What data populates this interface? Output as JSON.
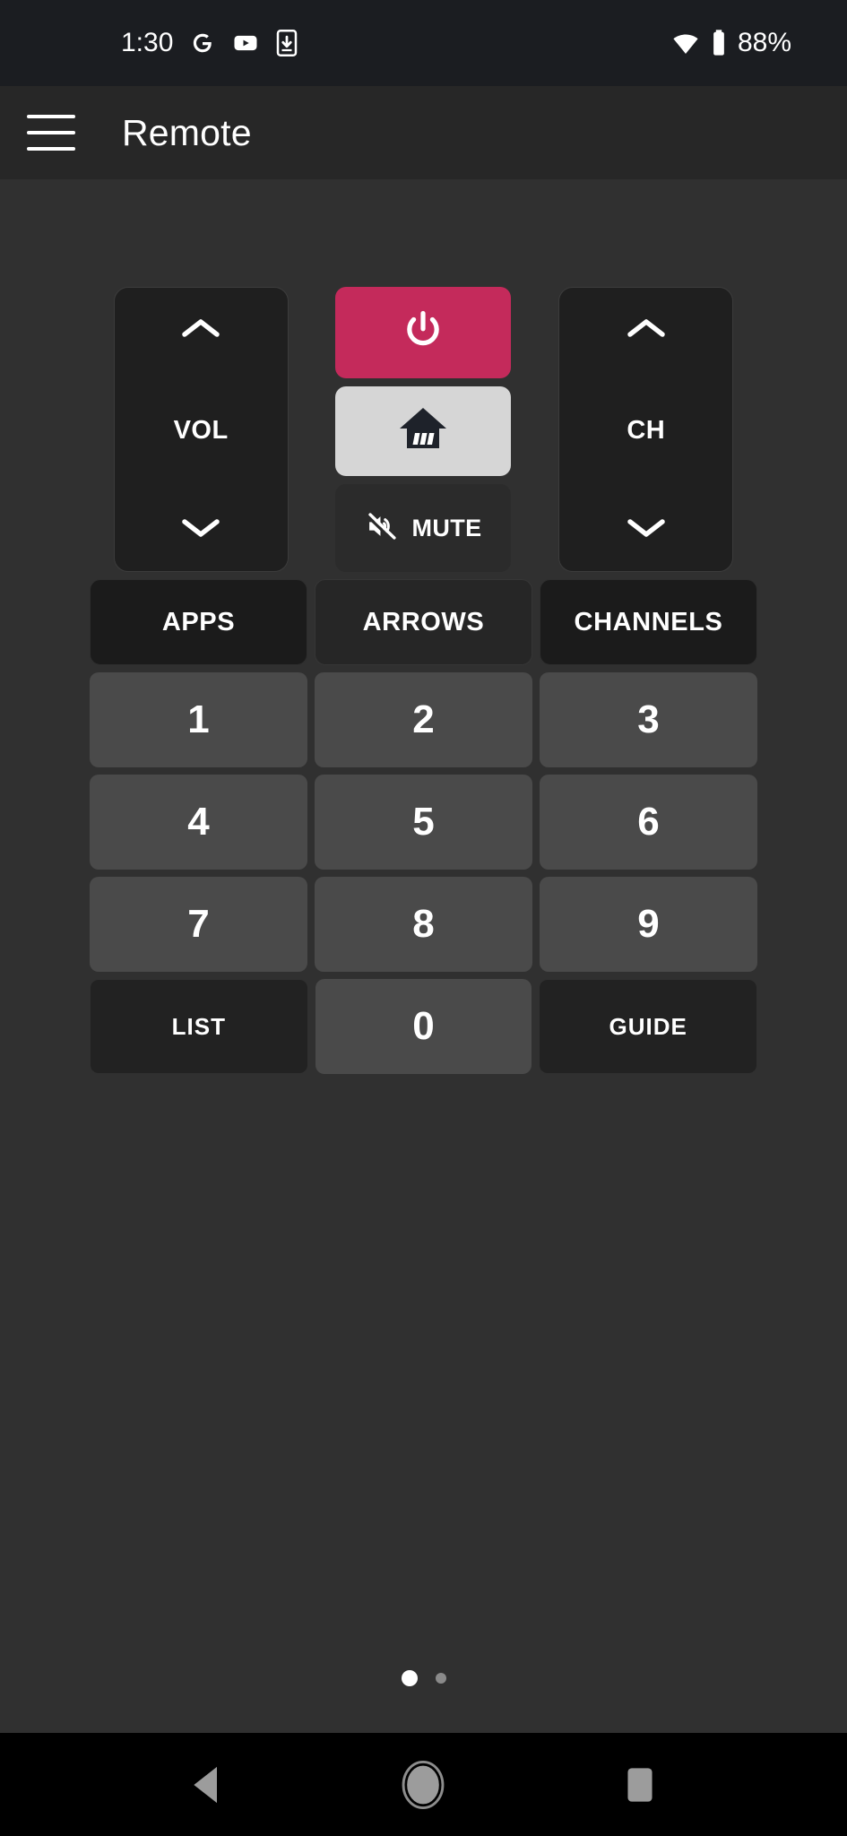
{
  "status_bar": {
    "time": "1:30",
    "battery_percent": "88%",
    "left_icons": [
      "google-icon",
      "youtube-icon",
      "phone-download-icon"
    ],
    "right_icons": [
      "wifi-icon",
      "battery-icon"
    ],
    "background_color": "#1b1d21"
  },
  "app_bar": {
    "menu_icon": "hamburger-menu-icon",
    "title": "Remote",
    "background_color": "#272727"
  },
  "remote": {
    "background_color": "#303030",
    "volume_rocker": {
      "up_icon": "chevron-up-icon",
      "label": "VOL",
      "down_icon": "chevron-down-icon"
    },
    "channel_rocker": {
      "up_icon": "chevron-up-icon",
      "label": "CH",
      "down_icon": "chevron-down-icon"
    },
    "power_button": {
      "icon": "power-icon",
      "color": "#c42a5b"
    },
    "home_button": {
      "icon": "home-house-icon",
      "color": "#d6d6d6"
    },
    "mute_button": {
      "icon": "volume-mute-icon",
      "label": "MUTE"
    },
    "function_row": [
      {
        "label": "APPS",
        "style": "dark"
      },
      {
        "label": "ARROWS",
        "style": "mid"
      },
      {
        "label": "CHANNELS",
        "style": "dark"
      }
    ],
    "keypad": [
      [
        "1",
        "2",
        "3"
      ],
      [
        "4",
        "5",
        "6"
      ],
      [
        "7",
        "8",
        "9"
      ]
    ],
    "bottom_row": {
      "list_label": "LIST",
      "zero_label": "0",
      "guide_label": "GUIDE"
    },
    "pagination": {
      "total": 2,
      "active_index": 0
    }
  },
  "nav_bar": {
    "back_icon": "back-triangle-icon",
    "home_icon": "home-circle-icon",
    "recents_icon": "recents-square-icon",
    "background_color": "#000000"
  }
}
